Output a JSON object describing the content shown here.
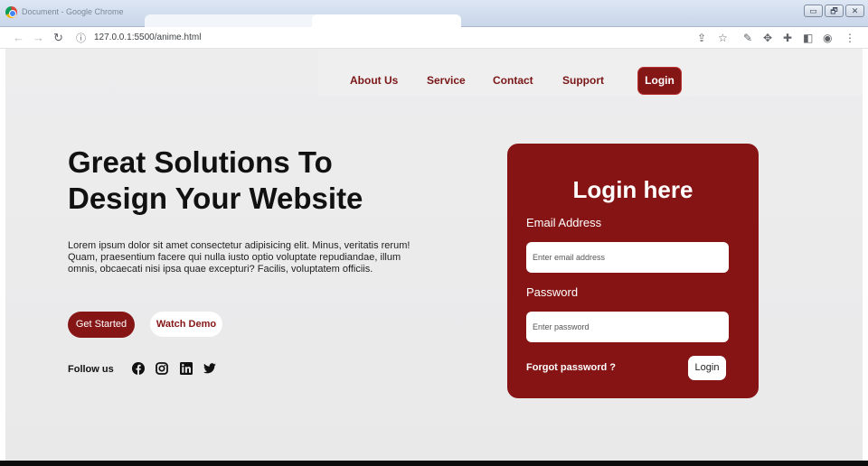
{
  "browser": {
    "window_title": "Document - Google Chrome",
    "url": "127.0.0.1:5500/anime.html",
    "window_buttons": [
      "▭",
      "🗗",
      "✕"
    ]
  },
  "nav": {
    "links": [
      "About Us",
      "Service",
      "Contact",
      "Support"
    ],
    "login_label": "Login"
  },
  "hero": {
    "title_line1": "Great Solutions To",
    "title_line2": "Design Your Website",
    "text": "Lorem ipsum dolor sit amet consectetur adipisicing elit. Minus, veritatis rerum! Quam, praesentium facere qui nulla iusto optio voluptate repudiandae, illum omnis, obcaecati nisi ipsa quae excepturi? Facilis, voluptatem officiis.",
    "get_started_label": "Get Started",
    "watch_demo_label": "Watch Demo",
    "follow_label": "Follow us",
    "social_icons": [
      "facebook-icon",
      "instagram-icon",
      "linkedin-icon",
      "twitter-icon"
    ]
  },
  "login_card": {
    "title": "Login here",
    "email_label": "Email Address",
    "email_placeholder": "Enter email address",
    "password_label": "Password",
    "password_placeholder": "Enter password",
    "forgot_label": "Forgot password ?",
    "login_label": "Login"
  },
  "colors": {
    "brand": "#861616",
    "page_bg": "#ebebec"
  }
}
